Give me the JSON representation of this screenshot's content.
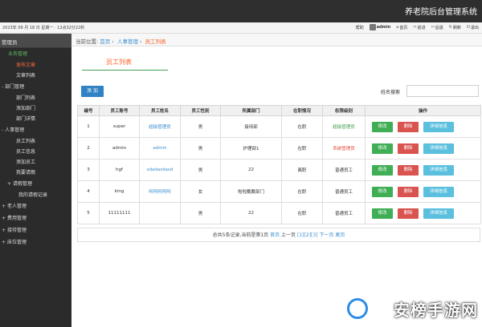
{
  "header": {
    "brand": "养老院后台管理系统",
    "datetime": "2023年 09 月 18 日 星期一 · 12点32分22秒",
    "links": {
      "help": "帮助",
      "user": "admin",
      "home": "首页",
      "forward": "前进",
      "back": "后退",
      "refresh": "刷新",
      "logout": "退出"
    }
  },
  "sidebar": {
    "title": "管理员",
    "items": [
      {
        "label": "业务管理",
        "kind": "first"
      },
      {
        "label": "发布文章",
        "kind": "sub",
        "active": true
      },
      {
        "label": "文章列表",
        "kind": "sub"
      },
      {
        "label": "部门管理",
        "kind": "top2",
        "toggle": "-"
      },
      {
        "label": "部门列表",
        "kind": "sub"
      },
      {
        "label": "添加部门",
        "kind": "sub"
      },
      {
        "label": "部门详情",
        "kind": "sub"
      },
      {
        "label": "人事管理",
        "kind": "top2",
        "toggle": "-"
      },
      {
        "label": "员工列表",
        "kind": "sub"
      },
      {
        "label": "员工信息",
        "kind": "sub"
      },
      {
        "label": "添加员工",
        "kind": "sub"
      },
      {
        "label": "我要请假",
        "kind": "sub"
      },
      {
        "label": "请假管理",
        "kind": "top2b",
        "toggle": "+"
      },
      {
        "label": "我的请假记录",
        "kind": "sub",
        "deep": true
      },
      {
        "label": "老人管理",
        "kind": "top",
        "toggle": "+"
      },
      {
        "label": "费用管理",
        "kind": "top",
        "toggle": "+"
      },
      {
        "label": "接待管理",
        "kind": "top",
        "toggle": "+"
      },
      {
        "label": "床位管理",
        "kind": "top",
        "toggle": "+"
      }
    ]
  },
  "breadcrumb": {
    "prefix": "当前位置:",
    "home": "首页",
    "section": "人事管理",
    "current": "员工列表"
  },
  "main": {
    "title": "员工列表",
    "add_label": "添 加",
    "search_label": "姓名搜索",
    "search_placeholder": "",
    "columns": [
      "编号",
      "员工账号",
      "员工姓名",
      "员工性别",
      "所属部门",
      "在职情况",
      "权限级别",
      "操作"
    ],
    "rows": [
      {
        "id": "1",
        "account": "super",
        "name": "超级管理员",
        "gender": "男",
        "dept": "接待部",
        "status": "在职",
        "role": "超级管理员",
        "role_style": "green"
      },
      {
        "id": "2",
        "account": "admin",
        "name": "admin",
        "gender": "男",
        "dept": "护理部1",
        "status": "在职",
        "role": "系统管理员",
        "role_style": "red"
      },
      {
        "id": "3",
        "account": "hgf",
        "name": "sdadasdasd",
        "gender": "男",
        "dept": "22",
        "status": "离职",
        "role": "普通员工",
        "role_style": "plain"
      },
      {
        "id": "4",
        "account": "king",
        "name": "呵呵呵呵呵",
        "gender": "女",
        "dept": "啦啦戴戴部门",
        "status": "在职",
        "role": "普通员工",
        "role_style": "plain"
      },
      {
        "id": "5",
        "account": "11111111",
        "name": "",
        "gender": "男",
        "dept": "22",
        "status": "在职",
        "role": "普通员工",
        "role_style": "plain"
      }
    ],
    "ops": {
      "edit": "修改",
      "del": "删除",
      "detail": "详细信息"
    },
    "pager": {
      "summary": "总共5条记录,当前是第1页",
      "first": "首页",
      "prev": "上一页",
      "pages": "[1][2][3]",
      "next": "下一页",
      "last": "尾页"
    }
  },
  "watermark": {
    "text": "安榜手游网"
  }
}
